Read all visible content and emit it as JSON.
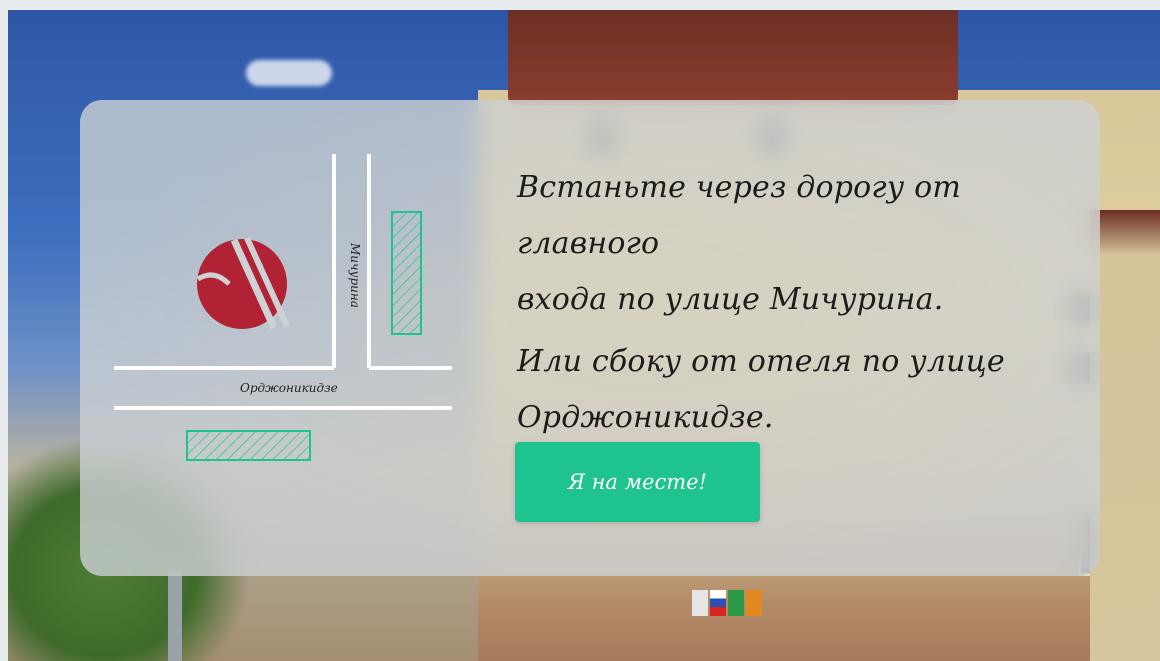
{
  "colors": {
    "button_bg": "#1fc38f",
    "logo_red": "#b12334",
    "street_line": "#ffffff",
    "hatch": "#1fc38f"
  },
  "map": {
    "street_vertical": "Мичурина",
    "street_horizontal": "Орджоникидзе",
    "logo_icon": "hotel-logo-icon",
    "pickup_zone_icon": "hatched-zone-icon"
  },
  "instructions": {
    "line1": "Встаньте через дорогу от главного",
    "line2": "входа по улице Мичурина.",
    "line3": "Или сбоку от отеля по улице",
    "line4": "Орджоникидзе."
  },
  "action": {
    "button_label": "Я на месте!"
  }
}
